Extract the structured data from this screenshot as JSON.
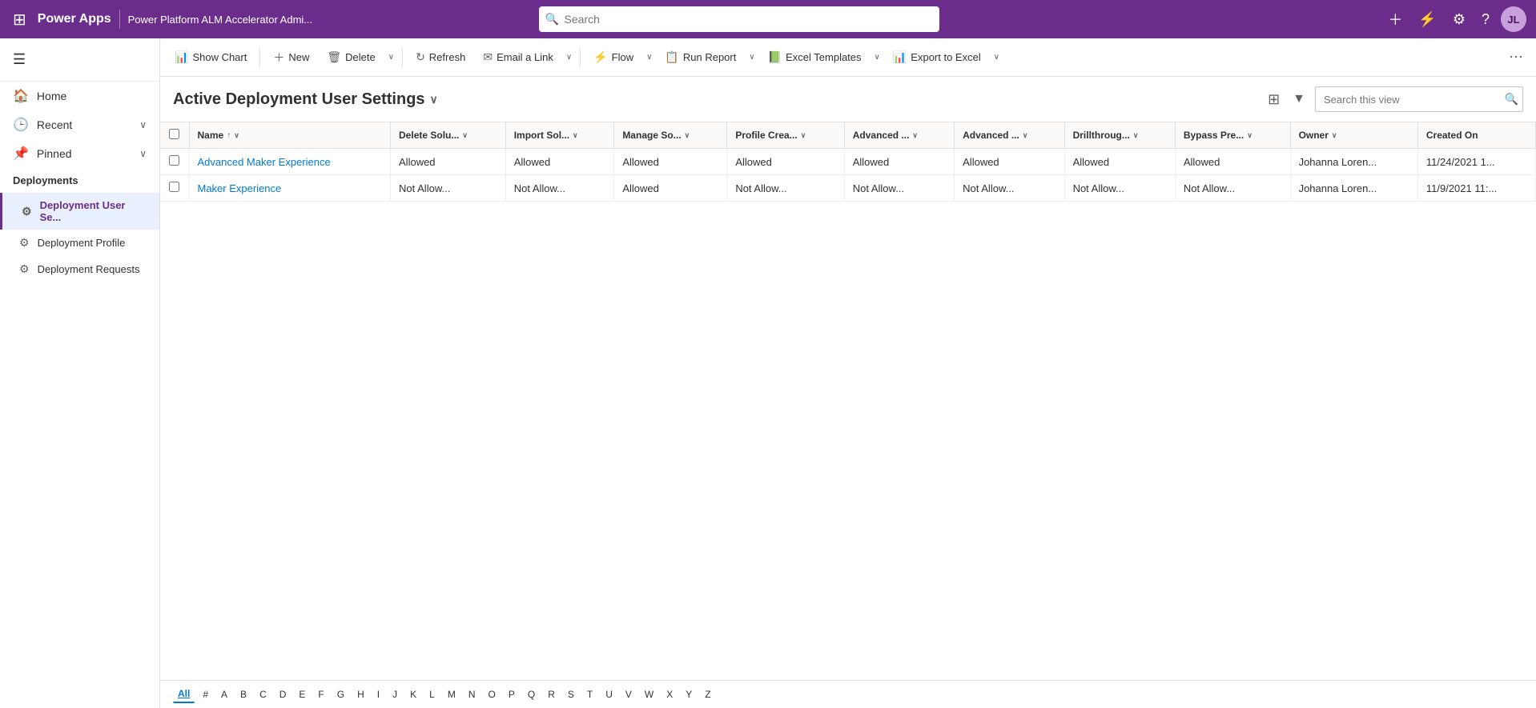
{
  "topnav": {
    "app_name": "Power Apps",
    "env_name": "Power Platform ALM Accelerator Admi...",
    "search_placeholder": "Search",
    "avatar_initials": "JL",
    "actions": {
      "plus_label": "+",
      "filter_label": "⚡",
      "settings_label": "⚙",
      "help_label": "?"
    }
  },
  "sidebar": {
    "hamburger_label": "☰",
    "home_label": "Home",
    "recent_label": "Recent",
    "pinned_label": "Pinned",
    "deployments_section": "Deployments",
    "items": [
      {
        "label": "Deployment User Se...",
        "active": true
      },
      {
        "label": "Deployment Profile",
        "active": false
      },
      {
        "label": "Deployment Requests",
        "active": false
      }
    ]
  },
  "toolbar": {
    "show_chart_label": "Show Chart",
    "new_label": "New",
    "delete_label": "Delete",
    "refresh_label": "Refresh",
    "email_link_label": "Email a Link",
    "flow_label": "Flow",
    "run_report_label": "Run Report",
    "excel_templates_label": "Excel Templates",
    "export_to_excel_label": "Export to Excel"
  },
  "view": {
    "title": "Active Deployment User Settings",
    "search_placeholder": "Search this view"
  },
  "table": {
    "columns": [
      {
        "label": "Name",
        "sort": "↑",
        "has_dropdown": true
      },
      {
        "label": "Delete Solu...",
        "has_dropdown": true
      },
      {
        "label": "Import Sol...",
        "has_dropdown": true
      },
      {
        "label": "Manage So...",
        "has_dropdown": true
      },
      {
        "label": "Profile Crea...",
        "has_dropdown": true
      },
      {
        "label": "Advanced ...",
        "has_dropdown": true
      },
      {
        "label": "Advanced ...",
        "has_dropdown": true
      },
      {
        "label": "Drillthroug...",
        "has_dropdown": true
      },
      {
        "label": "Bypass Pre...",
        "has_dropdown": true
      },
      {
        "label": "Owner",
        "has_dropdown": true
      },
      {
        "label": "Created On",
        "has_dropdown": false
      }
    ],
    "rows": [
      {
        "name": "Advanced Maker Experience",
        "name_link": true,
        "delete_sol": "Allowed",
        "import_sol": "Allowed",
        "manage_so": "Allowed",
        "profile_crea": "Allowed",
        "advanced1": "Allowed",
        "advanced2": "Allowed",
        "drillthrough": "Allowed",
        "bypass_pre": "Allowed",
        "owner": "Johanna Loren...",
        "created_on": "11/24/2021 1..."
      },
      {
        "name": "Maker Experience",
        "name_link": true,
        "delete_sol": "Not Allow...",
        "import_sol": "Not Allow...",
        "manage_so": "Allowed",
        "profile_crea": "Not Allow...",
        "advanced1": "Not Allow...",
        "advanced2": "Not Allow...",
        "drillthrough": "Not Allow...",
        "bypass_pre": "Not Allow...",
        "owner": "Johanna Loren...",
        "created_on": "11/9/2021 11:..."
      }
    ]
  },
  "pagination": {
    "letters": [
      "All",
      "#",
      "A",
      "B",
      "C",
      "D",
      "E",
      "F",
      "G",
      "H",
      "I",
      "J",
      "K",
      "L",
      "M",
      "N",
      "O",
      "P",
      "Q",
      "R",
      "S",
      "T",
      "U",
      "V",
      "W",
      "X",
      "Y",
      "Z"
    ]
  }
}
